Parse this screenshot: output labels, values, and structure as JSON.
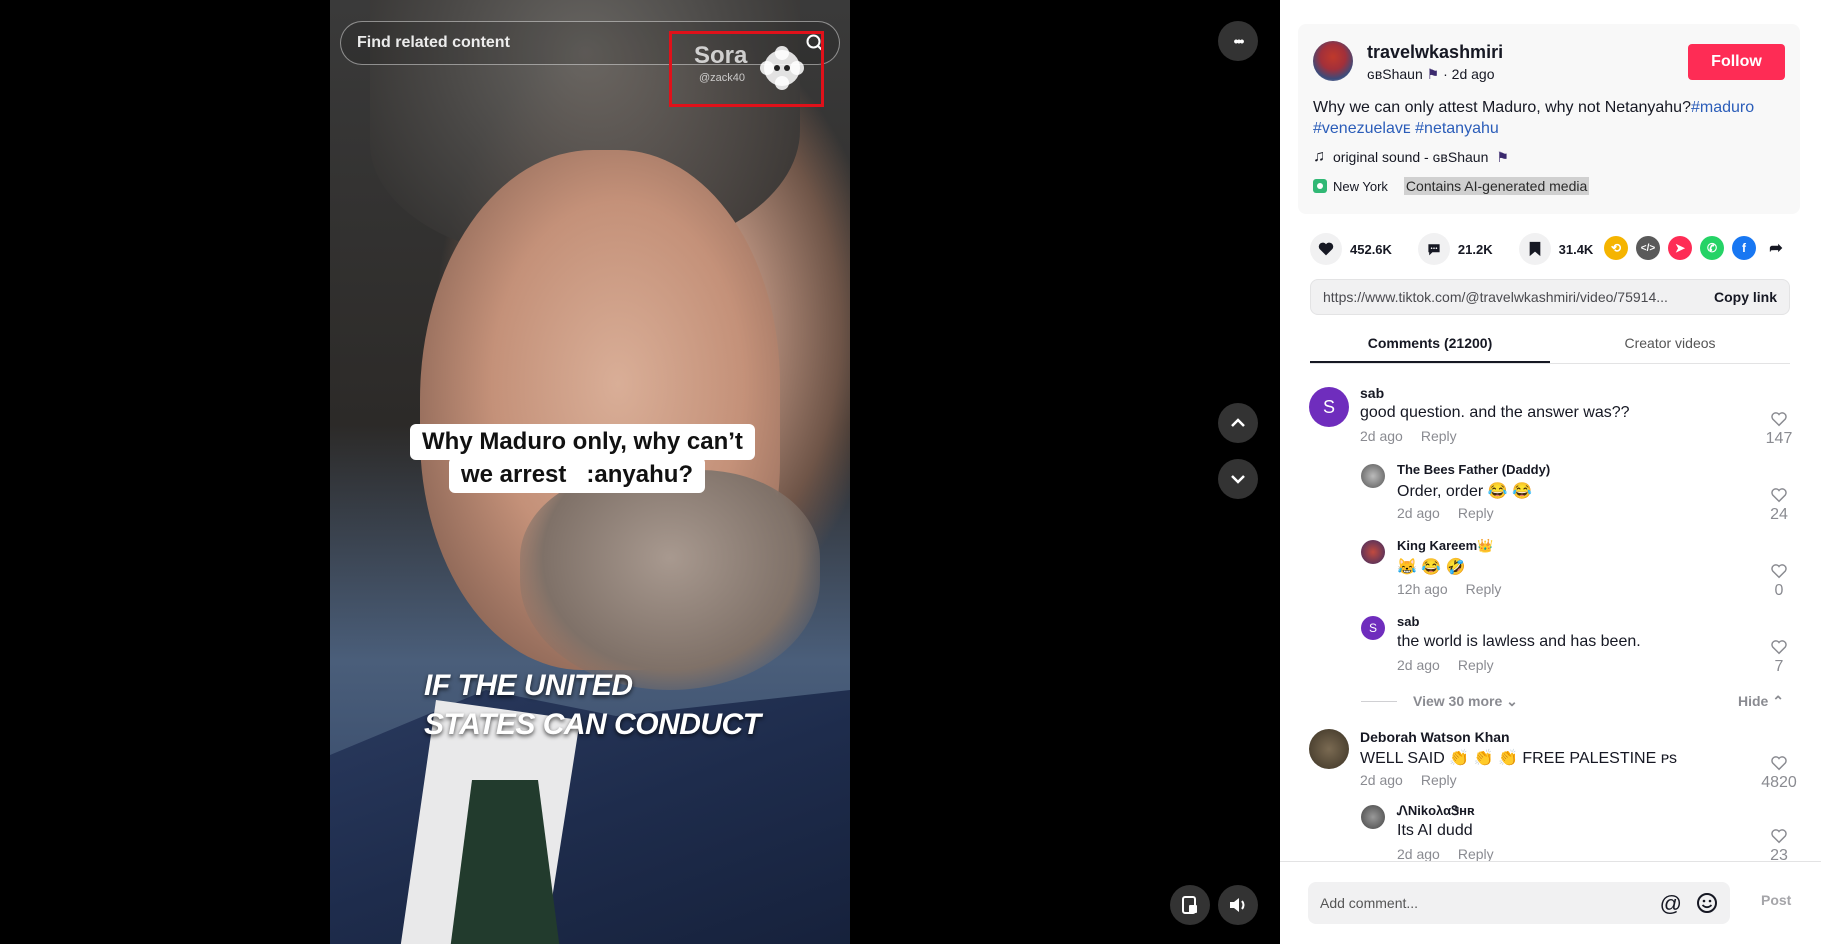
{
  "video": {
    "search_placeholder": "Find related content",
    "watermark": {
      "brand": "Sora",
      "handle": "@zack40"
    },
    "caption_line1": "Why Maduro only, why can’t",
    "caption_line2": "we arrest   ​​​ ‍ ​:anyahu?",
    "overlay_line1": "IF THE UNITED",
    "overlay_line2": "STATES CAN CONDUCT",
    "more_glyph": "•••"
  },
  "post": {
    "username": "travelwkashmiri",
    "display_name": "ɢʙShaun",
    "time_ago": "2d ago",
    "follow_label": "Follow",
    "description": "Why we can only attest Maduro, why not Netanyahu?",
    "hashtags": [
      "#maduro",
      "#venezuelaᴠᴇ",
      "#netanyahu"
    ],
    "sound": "original sound - ɢʙShaun",
    "location": "New York",
    "ai_label": "Contains AI-generated media"
  },
  "stats": {
    "likes": "452.6K",
    "comments": "21.2K",
    "saves": "31.4K"
  },
  "share_link": {
    "url": "https://www.tiktok.com/@travelwkashmiri/video/75914...",
    "copy_label": "Copy link"
  },
  "tabs": [
    {
      "label": "Comments (21200)",
      "active": true
    },
    {
      "label": "Creator videos",
      "active": false
    }
  ],
  "comments": [
    {
      "name": "sab",
      "text": "good question. and the answer was??",
      "time": "2d ago",
      "reply": "Reply",
      "likes": "147",
      "avatar_letter": "S"
    },
    {
      "name": "The Bees Father (Daddy)",
      "text": "Order, order 😂 😂",
      "time": "2d ago",
      "reply": "Reply",
      "likes": "24"
    },
    {
      "name": "King Kareem👑",
      "text": "😹 😂 🤣",
      "time": "12h ago",
      "reply": "Reply",
      "likes": "0"
    },
    {
      "name": "sab",
      "text": "the world is lawless and has been.",
      "time": "2d ago",
      "reply": "Reply",
      "likes": "7",
      "avatar_letter": "S"
    },
    {
      "name": "Deborah Watson Khan",
      "text": "WELL SAID 👏 👏 👏 FREE PALESTINE ᴘs",
      "time": "2d ago",
      "reply": "Reply",
      "likes": "4820"
    },
    {
      "name": "ᏁNikολαᏕʜʀ",
      "text": "Its AI dudd",
      "time": "2d ago",
      "reply": "Reply",
      "likes": "23"
    }
  ],
  "view_more": "View 30 more",
  "hide_label": "Hide",
  "footer": {
    "placeholder": "Add comment...",
    "post_label": "Post"
  },
  "colors": {
    "follow": "#fe2c55",
    "hashtag": "#2b5db9",
    "highlight_box": "#e0111a"
  }
}
